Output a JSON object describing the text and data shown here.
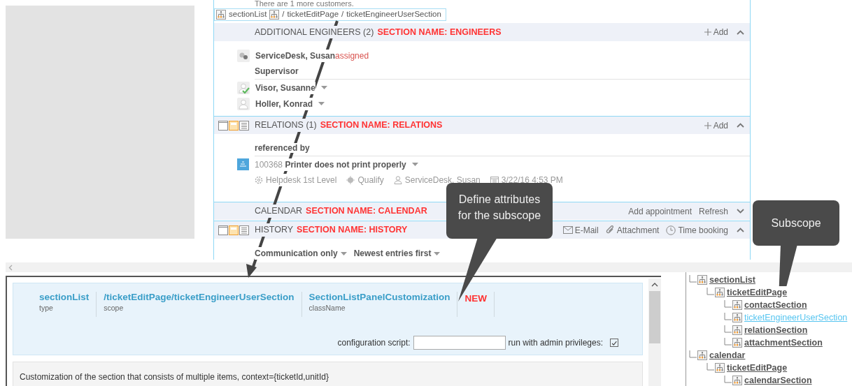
{
  "top_note": "There are 1 more customers.",
  "breadcrumb": [
    {
      "kind": "icon_link",
      "label": "sectionList"
    },
    {
      "kind": "icon"
    },
    {
      "kind": "separator",
      "label": "/"
    },
    {
      "kind": "link",
      "label": "ticketEditPage"
    },
    {
      "kind": "separator",
      "label": "/"
    },
    {
      "kind": "link",
      "label": "ticketEngineerUserSection"
    }
  ],
  "sections": [
    {
      "title": "ADDITIONAL ENGINEERS (2)",
      "section_name": "SECTION NAME: ENGINEERS",
      "view_icons": false,
      "expanded": true,
      "actions": [
        {
          "kind": "add",
          "label": "Add"
        }
      ],
      "body": [
        {
          "kind": "team",
          "name": "ServiceDesk, Susan",
          "status": "assigned",
          "approved": false,
          "menu": false
        },
        {
          "kind": "subheading",
          "text": "Supervisor"
        },
        {
          "kind": "person",
          "name": "Visor, Susanne",
          "approved": true,
          "menu": true
        },
        {
          "kind": "person",
          "name": "Holler, Konrad",
          "approved": false,
          "menu": true
        }
      ]
    },
    {
      "title": "RELATIONS (1)",
      "section_name": "SECTION NAME: RELATIONS",
      "view_icons": true,
      "expanded": true,
      "actions": [
        {
          "kind": "add",
          "label": "Add"
        }
      ],
      "body": [
        {
          "kind": "subheading",
          "text": "referenced by"
        },
        {
          "kind": "ticket",
          "number": "100368",
          "title": "Printer does not print properly",
          "meta": [
            {
              "kind": "team",
              "text": "Helpdesk 1st Level"
            },
            {
              "kind": "status",
              "text": "Qualify"
            },
            {
              "kind": "person",
              "text": "ServiceDesk, Susan"
            },
            {
              "kind": "date",
              "text": "3/22/16 4:53 PM"
            }
          ]
        }
      ]
    },
    {
      "title": "CALENDAR",
      "section_name": "SECTION NAME: CALENDAR",
      "view_icons": false,
      "expanded": false,
      "actions": [
        {
          "kind": "text",
          "label": "Add appointment"
        },
        {
          "kind": "text",
          "label": "Refresh"
        }
      ]
    },
    {
      "title": "HISTORY",
      "section_name": "SECTION NAME: HISTORY",
      "view_icons": true,
      "expanded": true,
      "actions": [
        {
          "kind": "email",
          "label": "E-Mail"
        },
        {
          "kind": "attachment",
          "label": "Attachment"
        },
        {
          "kind": "time",
          "label": "Time booking"
        }
      ],
      "body": [
        {
          "kind": "filters",
          "items": [
            "Communication only",
            "Newest entries first"
          ]
        }
      ]
    }
  ],
  "properties": [
    {
      "kind": "field",
      "value": "sectionList",
      "label": "type"
    },
    {
      "kind": "field",
      "value": "/ticketEditPage/ticketEngineerUserSection",
      "label": "scope"
    },
    {
      "kind": "field",
      "value": "SectionListPanelCustomization",
      "label": "className"
    },
    {
      "kind": "new",
      "value": "NEW"
    }
  ],
  "config": {
    "label": "configuration script:"
  },
  "admin": {
    "label": "run with admin privileges:",
    "checked": true
  },
  "description": "Customization of the section that consists of multiple items, context={ticketId,unitId}",
  "tree": [
    {
      "label": "sectionList",
      "selected": false,
      "children": [
        {
          "label": "ticketEditPage",
          "selected": false,
          "children": [
            {
              "label": "contactSection",
              "selected": false
            },
            {
              "label": "ticketEngineerUserSection",
              "selected": true
            },
            {
              "label": "relationSection",
              "selected": false
            },
            {
              "label": "attachmentSection",
              "selected": false
            }
          ]
        }
      ]
    },
    {
      "label": "calendar",
      "selected": false,
      "children": [
        {
          "label": "ticketEditPage",
          "selected": false,
          "children": [
            {
              "label": "calendarSection",
              "selected": false
            }
          ]
        }
      ]
    }
  ],
  "callouts": [
    {
      "kind": "attributes",
      "text": "Define attributes for the subscope"
    },
    {
      "kind": "subscope",
      "text": "Subscope"
    }
  ]
}
